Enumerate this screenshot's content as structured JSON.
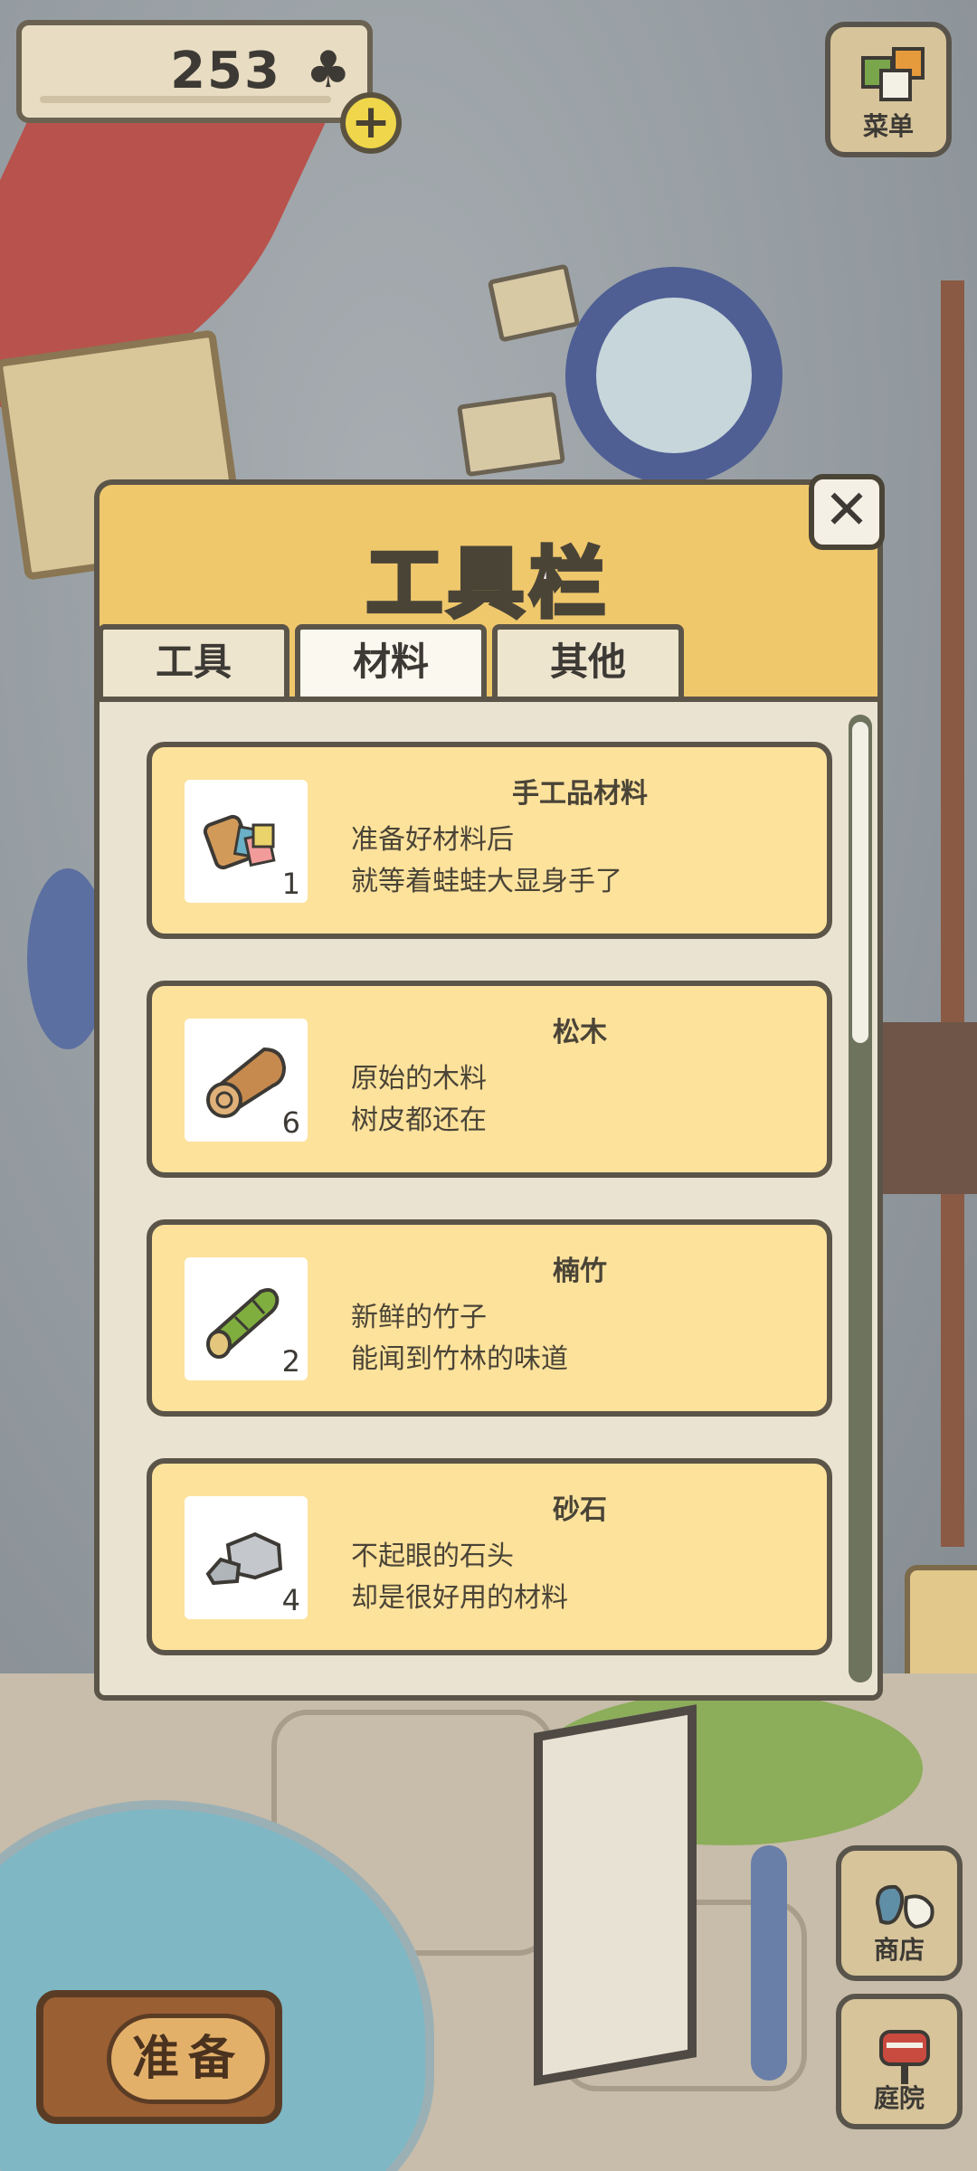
{
  "hud": {
    "clover_count": "253",
    "clover_icon": "clover-icon",
    "add_icon": "+",
    "menu_label": "菜单",
    "shop_label": "商店",
    "yard_label": "庭院",
    "prepare_label": "准备"
  },
  "panel": {
    "title": "工具栏",
    "close_icon": "✕",
    "tabs": [
      {
        "label": "工具",
        "active": false
      },
      {
        "label": "材料",
        "active": true
      },
      {
        "label": "其他",
        "active": false
      }
    ],
    "items": [
      {
        "name": "手工品材料",
        "desc1": "准备好材料后",
        "desc2": "就等着蛙蛙大显身手了",
        "qty": "1",
        "icon": "craft-materials-icon"
      },
      {
        "name": "松木",
        "desc1": "原始的木料",
        "desc2": "树皮都还在",
        "qty": "6",
        "icon": "pine-log-icon"
      },
      {
        "name": "楠竹",
        "desc1": "新鲜的竹子",
        "desc2": "能闻到竹林的味道",
        "qty": "2",
        "icon": "bamboo-icon"
      },
      {
        "name": "砂石",
        "desc1": "不起眼的石头",
        "desc2": "却是很好用的材料",
        "qty": "4",
        "icon": "stone-icon"
      }
    ]
  }
}
